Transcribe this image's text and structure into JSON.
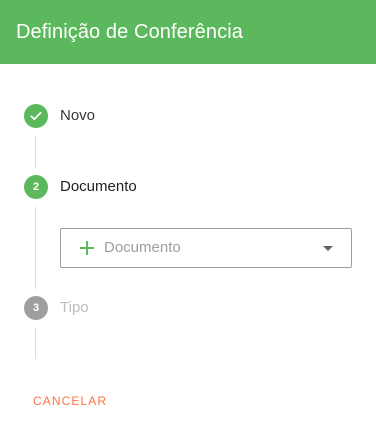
{
  "header": {
    "title": "Definição de Conferência"
  },
  "steps": [
    {
      "label": "Novo",
      "state": "done",
      "icon": "check-icon"
    },
    {
      "label": "Documento",
      "number": "2",
      "state": "active"
    },
    {
      "label": "Tipo",
      "number": "3",
      "state": "pending"
    }
  ],
  "document_select": {
    "placeholder": "Documento",
    "icon": "plus-icon"
  },
  "actions": {
    "cancel_label": "CANCELAR"
  },
  "colors": {
    "header": "#5cb85c",
    "step_active": "#5cb85c",
    "step_pending": "#9e9e9e",
    "cancel": "#ff7043"
  }
}
